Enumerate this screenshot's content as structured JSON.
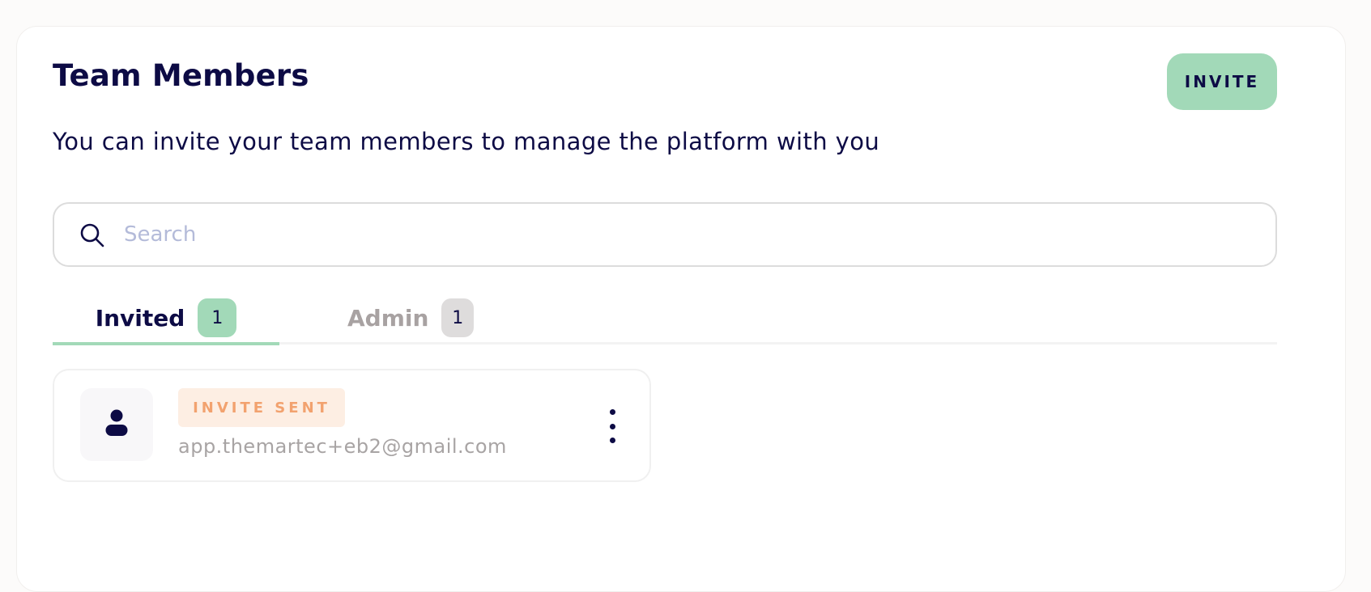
{
  "header": {
    "title": "Team Members",
    "invite_label": "INVITE",
    "subtitle": "You can invite your team members to manage the platform with you"
  },
  "search": {
    "placeholder": "Search",
    "value": "",
    "icon": "search-icon"
  },
  "tabs": [
    {
      "label": "Invited",
      "count": "1",
      "active": true
    },
    {
      "label": "Admin",
      "count": "1",
      "active": false
    }
  ],
  "members": [
    {
      "status": "INVITE SENT",
      "email": "app.themartec+eb2@gmail.com",
      "avatar_icon": "user-icon",
      "menu_icon": "more-vertical-icon"
    }
  ],
  "colors": {
    "brand_navy": "#0d0b45",
    "accent_green": "#a2d9b8",
    "status_orange": "#f2a26f",
    "status_orange_bg": "#fdeee3"
  }
}
